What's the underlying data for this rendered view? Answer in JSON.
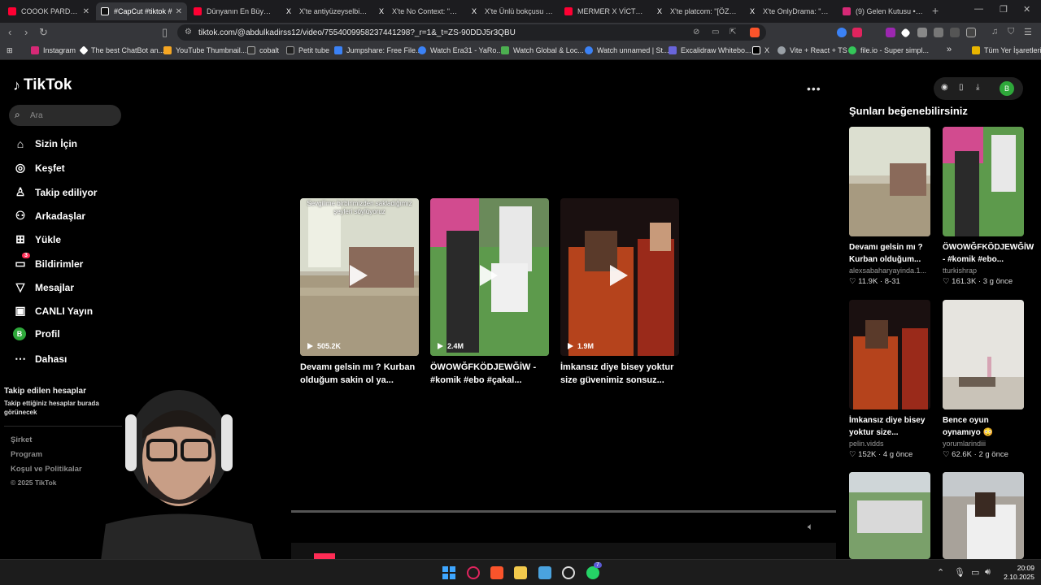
{
  "browser": {
    "tabs": [
      {
        "title": "COOOK PARDON",
        "color": "#ff0033"
      },
      {
        "title": "#CapCut #tiktok #",
        "color": "#111111"
      },
      {
        "title": "Dünyanın En Büyük Op",
        "color": "#ff0033"
      },
      {
        "title": "X'te antiyüzeyselbilgi:",
        "color": "#ffffff"
      },
      {
        "title": "X'te No Context: \"Adam",
        "color": "#ffffff"
      },
      {
        "title": "X'te Ünlü bokçusu 🙈",
        "color": "#ffffff"
      },
      {
        "title": "MERMER X VİCTORY L",
        "color": "#ff0033"
      },
      {
        "title": "X'te platcom: \"[ÖZEL]",
        "color": "#ffffff"
      },
      {
        "title": "X'te OnlyDrama: \"Ebo",
        "color": "#ffffff"
      },
      {
        "title": "(9) Gelen Kutusu • Soh",
        "color": "#d62976"
      }
    ],
    "new_tab": "+",
    "url": "tiktok.com/@abdulkadirss12/video/7554009958237441298?_r=1&_t=ZS-90DDJ5r3QBU",
    "bookmarks": [
      {
        "label": "Instagram",
        "color": "#d62976"
      },
      {
        "label": "The best ChatBot an...",
        "color": "#ffffff"
      },
      {
        "label": "YouTube Thumbnail...",
        "color": "#f5a623"
      },
      {
        "label": "cobalt",
        "color": "#333333"
      },
      {
        "label": "Petit tube",
        "color": "#222222"
      },
      {
        "label": "Jumpshare: Free File...",
        "color": "#3b82f6"
      },
      {
        "label": "Watch Era31 - YaRo...",
        "color": "#3b82f6"
      },
      {
        "label": "Watch Global & Loc...",
        "color": "#4caf50"
      },
      {
        "label": "Watch unnamed | St...",
        "color": "#3b82f6"
      },
      {
        "label": "Excalidraw Whitebo...",
        "color": "#6965db"
      },
      {
        "label": "X",
        "color": "#000000"
      },
      {
        "label": "Vite + React + TS",
        "color": "#9aa0a6"
      },
      {
        "label": "file.io - Super simpl...",
        "color": "#34c759"
      }
    ],
    "all_bookmarks": "Tüm Yer İşaretleri"
  },
  "tiktok": {
    "logo": "TikTok",
    "search_placeholder": "Ara",
    "nav": [
      {
        "label": "Sizin İçin",
        "icon": "home-icon",
        "glyph": "⌂"
      },
      {
        "label": "Keşfet",
        "icon": "compass-icon",
        "glyph": "◎"
      },
      {
        "label": "Takip ediliyor",
        "icon": "following-icon",
        "glyph": "♙"
      },
      {
        "label": "Arkadaşlar",
        "icon": "friends-icon",
        "glyph": "⚇"
      },
      {
        "label": "Yükle",
        "icon": "upload-icon",
        "glyph": "⊞"
      },
      {
        "label": "Bildirimler",
        "icon": "inbox-icon",
        "glyph": "▭",
        "badge": "3"
      },
      {
        "label": "Mesajlar",
        "icon": "messages-icon",
        "glyph": "▽"
      },
      {
        "label": "CANLI Yayın",
        "icon": "live-icon",
        "glyph": "▣"
      },
      {
        "label": "Profil",
        "icon": "profile-avatar",
        "glyph": "B"
      },
      {
        "label": "Dahası",
        "icon": "more-icon",
        "glyph": "⋯"
      }
    ],
    "following_heading": "Takip edilen hesaplar",
    "following_sub": "Takip ettiğiniz hesaplar burada görünecek",
    "footer": [
      "Şirket",
      "Program",
      "Koşul ve Politikalar",
      "© 2025 TikTok"
    ],
    "profile_initial": "B",
    "videos": [
      {
        "views": "505.2K",
        "title": "Devamı gelsin mı ? Kurban olduğum sakin ol ya...",
        "overlay": "Sevgilime birbirimizden sakladığımız şeyleri söylüyoruz"
      },
      {
        "views": "2.4M",
        "title": "ÖWOWĞFKÖDJEWĞİW - #komik #ebo #çakal..."
      },
      {
        "views": "1.9M",
        "title": "İmkansız diye bisey yoktur size güvenimiz sonsuz..."
      }
    ],
    "recommend_heading": "Şunları beğenebilirsiniz",
    "recommendations": [
      {
        "title": "Devamı gelsin mı ? Kurban olduğum...",
        "author": "alexsabaharyayinda.1...",
        "likes": "11.9K",
        "date": "8-31"
      },
      {
        "title": "ÖWOWĞFKÖDJEWĞİW - #komik #ebo...",
        "author": "tturkishrap",
        "likes": "161.3K",
        "date": "3 g önce"
      },
      {
        "title": "İmkansız diye bisey yoktur size...",
        "author": "pelin.vidds",
        "likes": "152K",
        "date": "4 g önce"
      },
      {
        "title": "Bence oyun oynamıyo 😳",
        "author": "yorumlarindiii",
        "likes": "62.6K",
        "date": "2 g önce"
      }
    ]
  },
  "taskbar": {
    "time": "20:09",
    "date": "2.10.2025",
    "whatsapp_badge": "7"
  }
}
